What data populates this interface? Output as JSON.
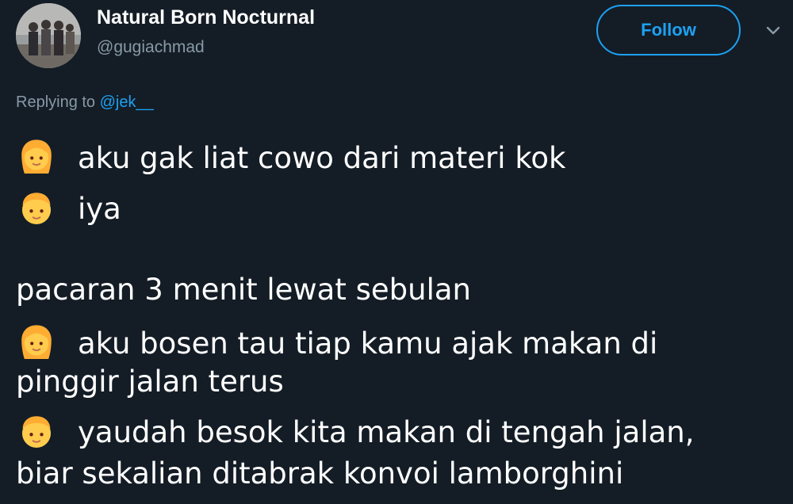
{
  "user": {
    "display_name": "Natural Born Nocturnal",
    "handle": "@gugiachmad"
  },
  "actions": {
    "follow_label": "Follow"
  },
  "reply": {
    "prefix": "Replying to ",
    "mention": "@jek__"
  },
  "tweet": {
    "lines": [
      {
        "emoji": "girl-emoji",
        "text": "aku gak liat cowo dari materi kok"
      },
      {
        "emoji": "boy-emoji",
        "text": "iya"
      },
      {
        "emoji": "",
        "text": "pacaran 3 menit lewat sebulan"
      },
      {
        "emoji": "girl-emoji",
        "text": "aku bosen tau tiap kamu ajak makan di"
      },
      {
        "emoji": "",
        "text": "pinggir jalan terus"
      },
      {
        "emoji": "boy-emoji",
        "text": "yaudah besok kita makan di tengah jalan,"
      },
      {
        "emoji": "",
        "text": "biar sekalian ditabrak konvoi lamborghini"
      }
    ]
  },
  "colors": {
    "background": "#141d26",
    "accent": "#1da1f2",
    "secondary_text": "#8899a6",
    "emoji_skin": "#ffcc4d",
    "emoji_hair": "#ffac33"
  }
}
